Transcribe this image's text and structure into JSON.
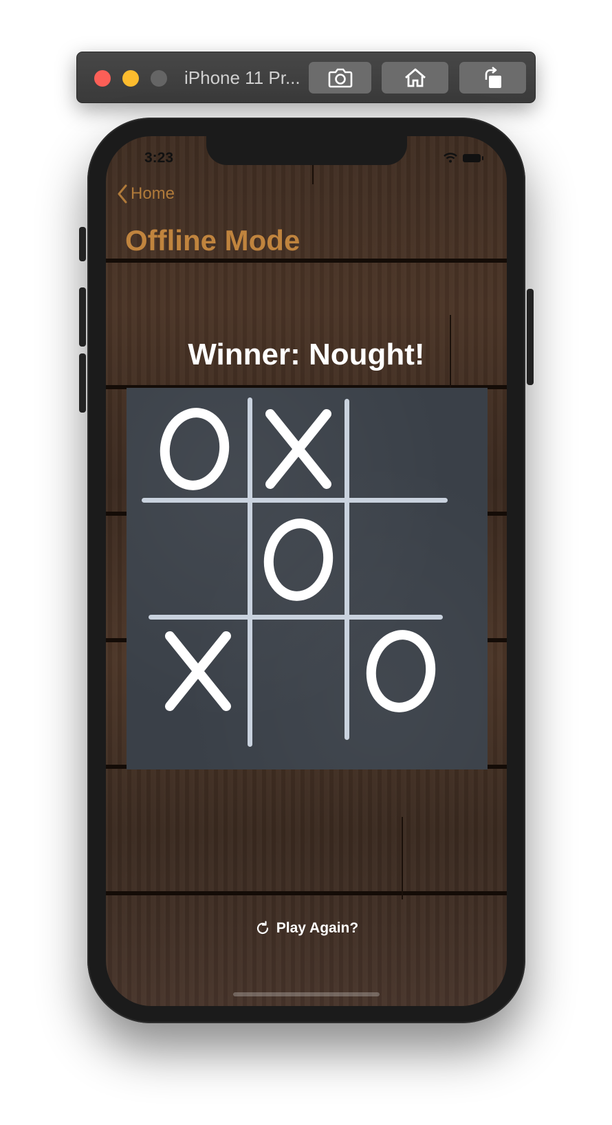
{
  "simulator": {
    "title": "iPhone 11 Pr...",
    "buttons": [
      "camera-icon",
      "home-icon",
      "rotate-icon"
    ]
  },
  "status_bar": {
    "time": "3:23"
  },
  "nav": {
    "back_label": "Home",
    "title": "Offline Mode"
  },
  "game": {
    "winner_text": "Winner: Nought!",
    "board": [
      [
        "O",
        "X",
        ""
      ],
      [
        "",
        "O",
        ""
      ],
      [
        "X",
        "",
        "O"
      ]
    ],
    "play_again_label": "Play Again?"
  },
  "colors": {
    "accent": "#c0843e",
    "chalk": "#ffffff",
    "chalk_grid": "#c9d2de",
    "board": "#3a4048"
  }
}
